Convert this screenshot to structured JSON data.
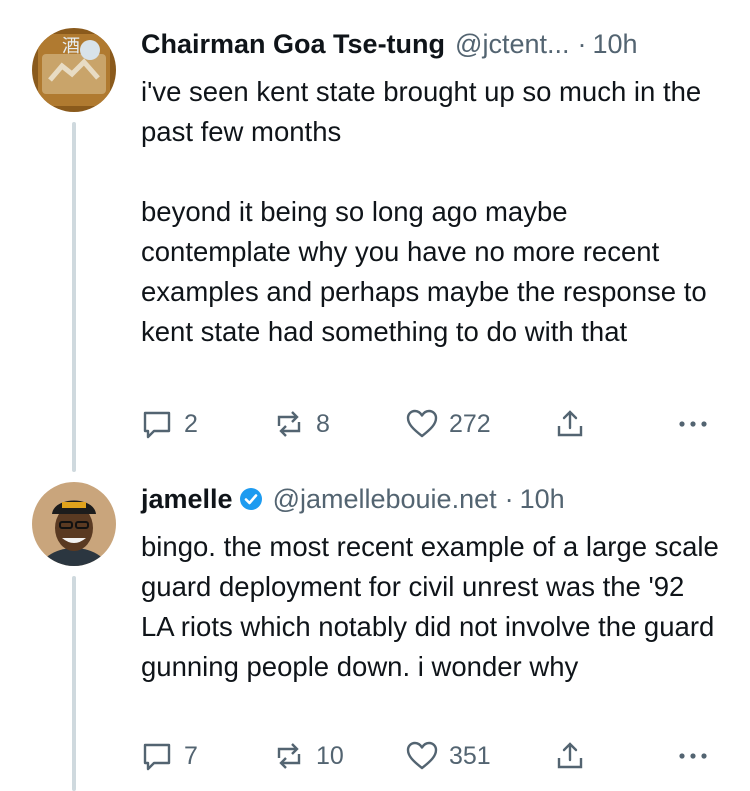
{
  "posts": [
    {
      "display_name": "Chairman Goa Tse-tung",
      "handle": "@jctent...",
      "separator": "·",
      "time": "10h",
      "text": "i've seen kent state brought up so much in the past few months\n\nbeyond it being so long ago maybe contemplate why you have no more recent examples and perhaps maybe the response to kent state had something to do with that",
      "replies": "2",
      "reposts": "8",
      "likes": "272",
      "avatar_icon": "restaurant-sign-avatar"
    },
    {
      "display_name": "jamelle",
      "verified": true,
      "handle": "@jamellebouie.net",
      "separator": "·",
      "time": "10h",
      "text": "bingo. the most recent example of a large scale guard deployment for civil unrest was the '92 LA riots which notably did not involve the guard gunning people down. i wonder why",
      "replies": "7",
      "reposts": "10",
      "likes": "351",
      "avatar_icon": "person-in-cap-avatar"
    }
  ],
  "colors": {
    "text": "#0f1419",
    "secondary": "#536471",
    "verified": "#1d9bf0",
    "thread_line": "#cfd9de"
  }
}
